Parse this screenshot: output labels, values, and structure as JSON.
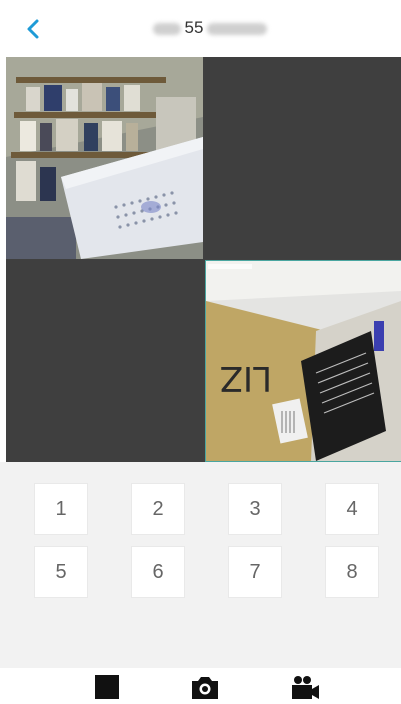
{
  "header": {
    "title_visible_part": "55",
    "back_icon": "chevron-left-icon",
    "accent_color": "#1e9bd7"
  },
  "video_grid": {
    "channels": [
      {
        "slot": 1,
        "state": "live",
        "content": "camera-feed"
      },
      {
        "slot": 2,
        "state": "empty"
      },
      {
        "slot": 3,
        "state": "empty"
      },
      {
        "slot": 4,
        "state": "live",
        "content": "camera-feed",
        "selected": true
      }
    ],
    "selected_border_color": "#4aa6a0"
  },
  "keypad": {
    "keys": [
      "1",
      "2",
      "3",
      "4",
      "5",
      "6",
      "7",
      "8"
    ]
  },
  "toolbar": {
    "stop_icon": "stop-icon",
    "snapshot_icon": "camera-icon",
    "record_icon": "video-camera-icon"
  }
}
